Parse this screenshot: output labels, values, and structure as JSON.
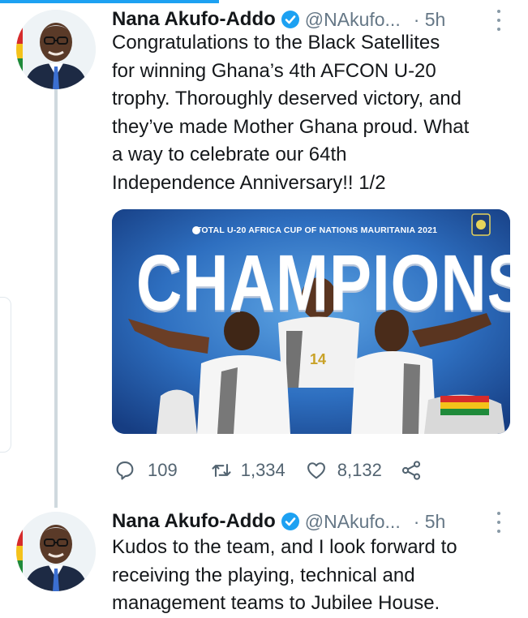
{
  "tweets": [
    {
      "author": "Nana Akufo-Addo",
      "handle": "@NAkufo...",
      "time": "· 5h",
      "text": "Congratulations to the Black Satellites\nfor winning Ghana’s 4th AFCON U-20\ntrophy. Thoroughly deserved victory, and\nthey’ve made Mother Ghana proud. What\na way to celebrate our 64th\nIndependence Anniversary!! 1/2",
      "media": {
        "caption": "TOTAL U-20 AFRICA CUP OF NATIONS MAURITANIA 2021",
        "headline": "CHAMPIONS",
        "jersey_number": "14"
      },
      "actions": {
        "replies": "109",
        "retweets": "1,334",
        "likes": "8,132"
      }
    },
    {
      "author": "Nana Akufo-Addo",
      "handle": "@NAkufo...",
      "time": "· 5h",
      "text": "Kudos to the team, and I look forward to\nreceiving the playing, technical and\nmanagement teams to Jubilee House."
    }
  ],
  "colors": {
    "accent": "#1da1f2",
    "verified": "#1da1f2",
    "muted": "#657786",
    "thread_line": "#cfd9de"
  },
  "icons": [
    "verified-badge-icon",
    "more-icon",
    "reply-icon",
    "retweet-icon",
    "like-icon",
    "share-icon"
  ]
}
